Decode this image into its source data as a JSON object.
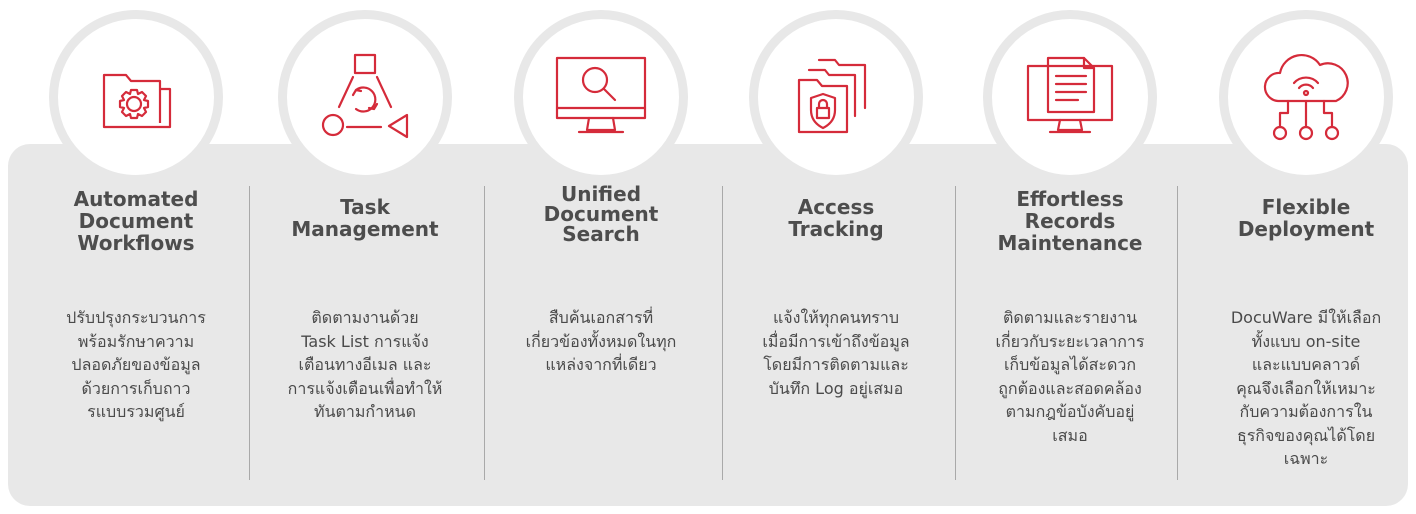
{
  "colors": {
    "accent": "#d52b3a",
    "panel": "#e8e8e8",
    "text": "#4d4d4d"
  },
  "features": [
    {
      "icon": "folder-gear-icon",
      "title": [
        "Automated",
        "Document",
        "Workflows"
      ],
      "desc": [
        "ปรับปรุงกระบวนการ",
        "พร้อมรักษาความ",
        "ปลอดภัยของข้อมูล",
        "ด้วยการเก็บถาว",
        "รแบบรวมศูนย์"
      ]
    },
    {
      "icon": "task-cycle-icon",
      "title": [
        "Task",
        "Management"
      ],
      "desc": [
        "ติดตามงานด้วย",
        "Task List การแจ้ง",
        "เตือนทางอีเมล และ",
        "การแจ้งเตือนเพื่อทำให้",
        "ทันตามกำหนด"
      ]
    },
    {
      "icon": "monitor-search-icon",
      "title": [
        "Unified",
        "Document",
        "Search"
      ],
      "desc": [
        "สืบค้นเอกสารที่",
        "เกี่ยวข้องทั้งหมดในทุก",
        "แหล่งจากที่เดียว"
      ]
    },
    {
      "icon": "folder-shield-lock-icon",
      "title": [
        "Access",
        "Tracking"
      ],
      "desc": [
        "แจ้งให้ทุกคนทราบ",
        "เมื่อมีการเข้าถึงข้อมูล",
        "โดยมีการติดตามและ",
        "บันทึก Log อยู่เสมอ"
      ]
    },
    {
      "icon": "monitor-document-icon",
      "title": [
        "Effortless",
        "Records",
        "Maintenance"
      ],
      "desc": [
        "ติดตามและรายงาน",
        "เกี่ยวกับระยะเวลาการ",
        "เก็บข้อมูลได้สะดวก",
        "ถูกต้องและสอดคล้อง",
        "ตามกฎข้อบังคับอยู่",
        "เสมอ"
      ]
    },
    {
      "icon": "cloud-network-icon",
      "title": [
        "Flexible",
        "Deployment"
      ],
      "desc": [
        "DocuWare มีให้เลือก",
        "ทั้งแบบ on-site",
        "และแบบคลาวด์",
        "คุณจึงเลือกให้เหมาะ",
        "กับความต้องการใน",
        "ธุรกิจของคุณได้โดย",
        "เฉพาะ"
      ]
    }
  ]
}
